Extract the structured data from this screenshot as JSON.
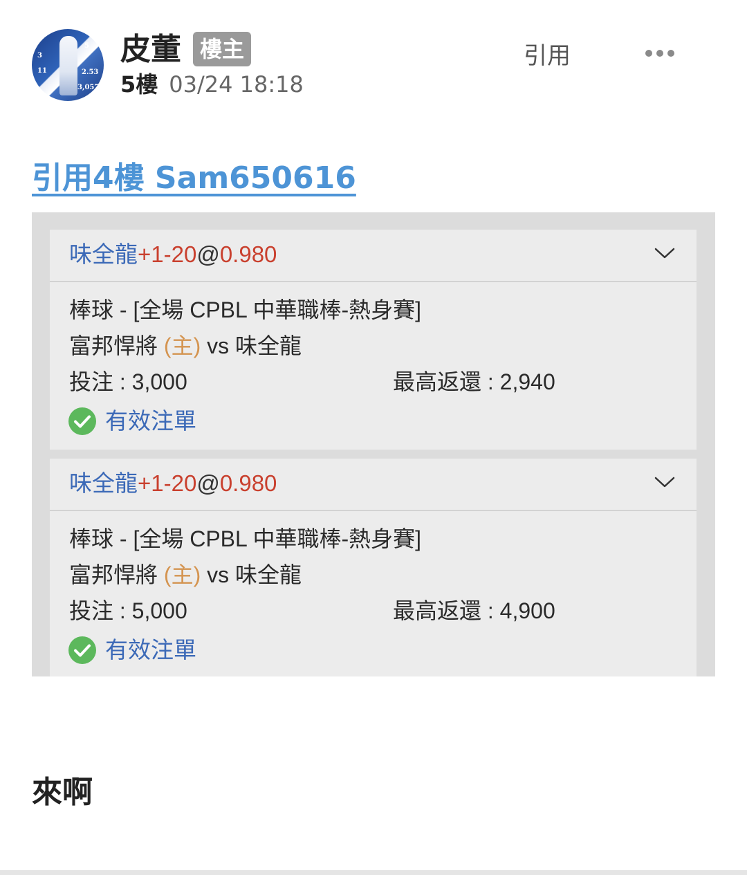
{
  "header": {
    "avatar_stats": [
      "5",
      "3",
      "11",
      "2.53",
      "3,057"
    ],
    "author_name": "皮董",
    "op_badge": "樓主",
    "floor": "5樓",
    "time": "03/24 18:18",
    "quote_label": "引用",
    "more_icon": "more-horizontal-icon"
  },
  "quote_link": "引用4樓 Sam650616",
  "bets": [
    {
      "team": "味全龍",
      "handicap": "+1-20",
      "at": "@",
      "odds": "0.980",
      "league": "棒球 - [全場 CPBL 中華職棒-熱身賽]",
      "home_team": "富邦悍將",
      "home_tag": "(主)",
      "vs": "vs",
      "away_team": "味全龍",
      "stake": "投注 : 3,000",
      "max_return": "最高返還 : 2,940",
      "status": "有效注單"
    },
    {
      "team": "味全龍",
      "handicap": "+1-20",
      "at": "@",
      "odds": "0.980",
      "league": "棒球 - [全場 CPBL 中華職棒-熱身賽]",
      "home_team": "富邦悍將",
      "home_tag": "(主)",
      "vs": "vs",
      "away_team": "味全龍",
      "stake": "投注 : 5,000",
      "max_return": "最高返還 : 4,900",
      "status": "有效注單"
    }
  ],
  "post_text": "來啊",
  "colors": {
    "link_blue": "#4d94d6",
    "team_blue": "#3b69b7",
    "odds_red": "#c9402e",
    "home_orange": "#d49450",
    "valid_green": "#5cb85c",
    "badge_gray": "#9a9a9a"
  }
}
